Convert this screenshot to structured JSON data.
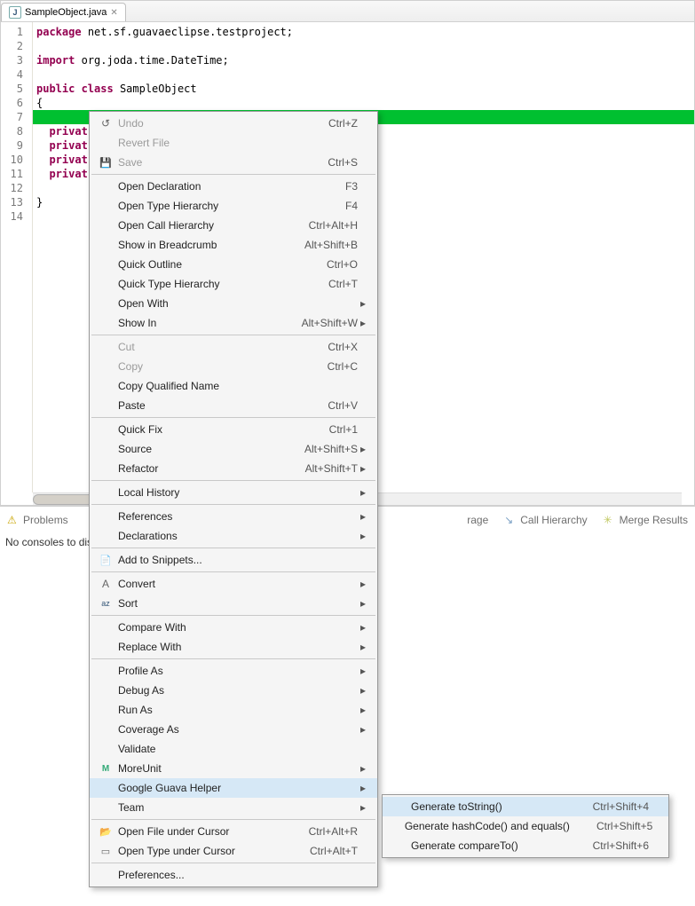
{
  "tab": {
    "filename": "SampleObject.java"
  },
  "code": {
    "lines": [
      "package net.sf.guavaeclipse.testproject;",
      "",
      "import org.joda.time.DateTime;",
      "",
      "public class SampleObject",
      "{",
      "",
      "  privat",
      "  privat",
      "  privat",
      "  privat",
      "",
      "}",
      ""
    ],
    "line_numbers": [
      "1",
      "2",
      "3",
      "4",
      "5",
      "6",
      "7",
      "8",
      "9",
      "10",
      "11",
      "12",
      "13",
      "14"
    ]
  },
  "lower_tabs": {
    "problems": "Problems",
    "coverage_truncated": "rage",
    "call_hierarchy": "Call Hierarchy",
    "merge_results": "Merge Results"
  },
  "console_msg": "No consoles to dis",
  "menu": {
    "undo": "Undo",
    "undo_accel": "Ctrl+Z",
    "revert": "Revert File",
    "save": "Save",
    "save_accel": "Ctrl+S",
    "open_decl": "Open Declaration",
    "open_decl_accel": "F3",
    "open_th": "Open Type Hierarchy",
    "open_th_accel": "F4",
    "open_ch": "Open Call Hierarchy",
    "open_ch_accel": "Ctrl+Alt+H",
    "breadcrumb": "Show in Breadcrumb",
    "breadcrumb_accel": "Alt+Shift+B",
    "q_outline": "Quick Outline",
    "q_outline_accel": "Ctrl+O",
    "q_th": "Quick Type Hierarchy",
    "q_th_accel": "Ctrl+T",
    "open_with": "Open With",
    "show_in": "Show In",
    "show_in_accel": "Alt+Shift+W",
    "cut": "Cut",
    "cut_accel": "Ctrl+X",
    "copy": "Copy",
    "copy_accel": "Ctrl+C",
    "copy_qn": "Copy Qualified Name",
    "paste": "Paste",
    "paste_accel": "Ctrl+V",
    "quick_fix": "Quick Fix",
    "quick_fix_accel": "Ctrl+1",
    "source": "Source",
    "source_accel": "Alt+Shift+S",
    "refactor": "Refactor",
    "refactor_accel": "Alt+Shift+T",
    "local_history": "Local History",
    "references": "References",
    "declarations": "Declarations",
    "snippets": "Add to Snippets...",
    "convert": "Convert",
    "sort": "Sort",
    "compare_with": "Compare With",
    "replace_with": "Replace With",
    "profile_as": "Profile As",
    "debug_as": "Debug As",
    "run_as": "Run As",
    "coverage_as": "Coverage As",
    "validate": "Validate",
    "moreunit": "MoreUnit",
    "guava": "Google Guava Helper",
    "team": "Team",
    "open_file_cursor": "Open File under Cursor",
    "open_file_cursor_accel": "Ctrl+Alt+R",
    "open_type_cursor": "Open Type under Cursor",
    "open_type_cursor_accel": "Ctrl+Alt+T",
    "preferences": "Preferences..."
  },
  "submenu": {
    "gen_tostring": "Generate toString()",
    "gen_tostring_accel": "Ctrl+Shift+4",
    "gen_hasheq": "Generate hashCode() and equals()",
    "gen_hasheq_accel": "Ctrl+Shift+5",
    "gen_compare": "Generate compareTo()",
    "gen_compare_accel": "Ctrl+Shift+6"
  }
}
